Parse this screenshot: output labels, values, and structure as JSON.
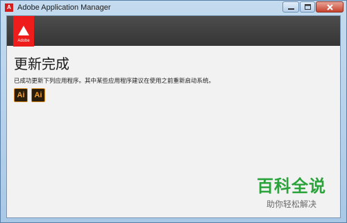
{
  "window": {
    "title": "Adobe Application Manager",
    "app_icon_letter": "A"
  },
  "brand": {
    "logo_text": "Adobe",
    "logo_color": "#ef1c1c"
  },
  "main": {
    "heading": "更新完成",
    "message": "已成功更新下列应用程序。其中某些应用程序建议在使用之前重新启动系统。",
    "updated_apps": [
      {
        "label": "Ai",
        "icon": "illustrator-icon"
      },
      {
        "label": "Ai",
        "icon": "illustrator-icon"
      }
    ]
  },
  "watermark": {
    "brand": "百科全说",
    "tagline": "助你轻松解决",
    "color": "#2aa33a"
  }
}
